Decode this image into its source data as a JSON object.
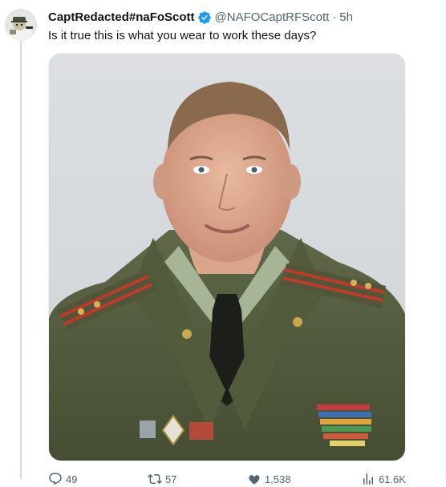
{
  "tweet": {
    "author": {
      "display_name": "CaptRedacted#naFoScott",
      "handle": "@NAFOCaptRFScott",
      "verified": true,
      "verified_icon": "verified-badge-icon"
    },
    "separator": "·",
    "time": "5h",
    "text": "Is it true this is what you wear to work these days?",
    "media": {
      "kind": "photo",
      "subject": "portrait of a man in an olive-green military dress uniform with red shoulder boards, ribbons and badges"
    },
    "actions": [
      {
        "icon": "reply-icon",
        "count": "49"
      },
      {
        "icon": "retweet-icon",
        "count": "57"
      },
      {
        "icon": "like-icon",
        "count": "1,538"
      },
      {
        "icon": "views-icon",
        "count": "61.6K"
      }
    ]
  },
  "colors": {
    "text_primary": "#0f1419",
    "text_secondary": "#536471",
    "verified_blue": "#1d9bf0",
    "thread_line": "#cfd9de"
  }
}
